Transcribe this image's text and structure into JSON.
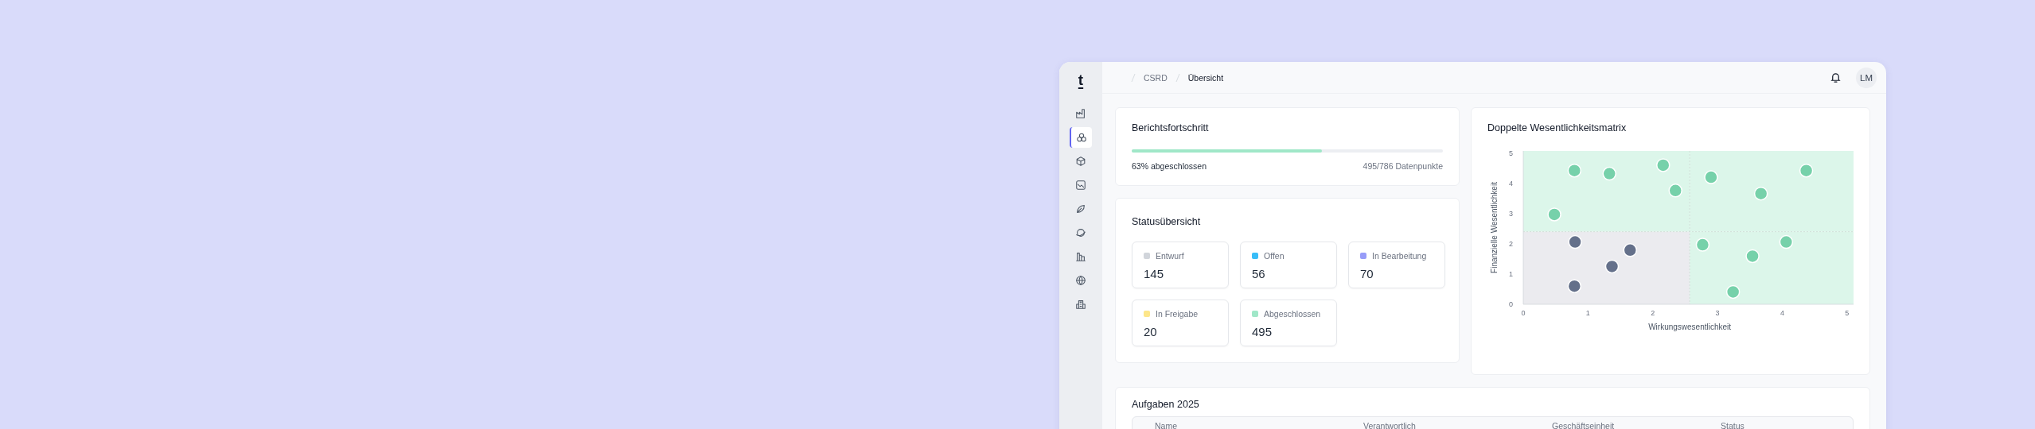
{
  "sidebar": {
    "logo": "t",
    "items": [
      {
        "selected": false
      },
      {
        "selected": true
      },
      {
        "selected": false
      },
      {
        "selected": false
      },
      {
        "selected": false
      },
      {
        "selected": false
      },
      {
        "selected": false
      },
      {
        "selected": false
      },
      {
        "selected": false
      }
    ]
  },
  "breadcrumb": [
    "CSRD",
    "Übersicht"
  ],
  "header": {
    "avatar": "LM"
  },
  "progress": {
    "title": "Berichtsfortschritt",
    "level": 0.61,
    "label": "63% abgeschlossen",
    "count": "495/786 Datenpunkte"
  },
  "status_overview": {
    "title": "Statusübersicht",
    "items": [
      {
        "label": "Entwurf",
        "value": "145",
        "color": "#d1d5db"
      },
      {
        "label": "Offen",
        "value": "56",
        "color": "#38bdf8"
      },
      {
        "label": "In Bearbeitung",
        "value": "70",
        "color": "#979cf8"
      },
      {
        "label": "In Freigabe",
        "value": "20",
        "color": "#fde68a"
      },
      {
        "label": "Abgeschlossen",
        "value": "495",
        "color": "#a0e7c8"
      }
    ]
  },
  "matrix": {
    "title": "Doppelte Wesentlichkeitsmatrix",
    "chart_data": {
      "type": "scatter",
      "xlabel": "Wirkungswesentlichkeit",
      "ylabel": "Finanzielle Wesentlichkeit",
      "xlim": [
        0,
        5.1
      ],
      "ylim": [
        0,
        5.07
      ],
      "ref_lines": [
        {
          "axis": "x",
          "value": 2.57
        },
        {
          "axis": "y",
          "value": 2.4
        }
      ],
      "xticks": [
        0,
        1,
        2,
        3,
        4,
        5
      ],
      "yticks": [
        0,
        1,
        2,
        3,
        4,
        5
      ],
      "series": [
        {
          "color": "#76d1aa",
          "x": [
            0.79,
            1.33,
            2.16,
            2.35,
            0.48,
            2.9,
            3.67,
            4.37,
            2.77,
            4.06,
            3.54,
            3.24
          ],
          "values": [
            4.42,
            4.32,
            4.6,
            3.76,
            2.97,
            4.2,
            3.66,
            4.42,
            1.97,
            2.06,
            1.59,
            0.41
          ]
        },
        {
          "color": "#64708a",
          "x": [
            0.8,
            1.65,
            1.37,
            0.79
          ],
          "values": [
            2.06,
            1.79,
            1.25,
            0.6
          ]
        }
      ]
    }
  },
  "tasks": {
    "title": "Aufgaben 2025",
    "columns": [
      "Name",
      "Verantwortlich",
      "Geschäftseinheit",
      "Status"
    ]
  }
}
